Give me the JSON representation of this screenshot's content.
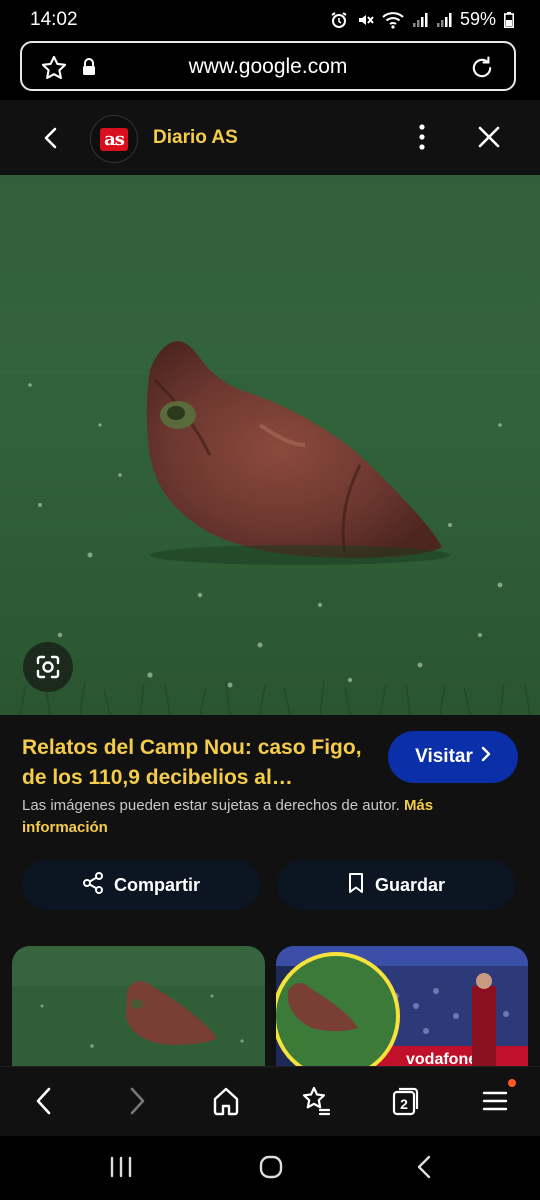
{
  "status_bar": {
    "time": "14:02",
    "battery": "59%"
  },
  "browser": {
    "url": "www.google.com",
    "tab_count": "2"
  },
  "header": {
    "site_name": "Diario AS",
    "logo_text": "as"
  },
  "result": {
    "title": "Relatos del Camp Nou: caso Figo, de los 110,9 decibelios al…",
    "visit_label": "Visitar",
    "copyright_text": "Las imágenes pueden estar sujetas a derechos de autor.",
    "more_info_label": "Más información",
    "share_label": "Compartir",
    "save_label": "Guardar"
  },
  "thumbnails": [
    {
      "banner_text": "vodafone"
    }
  ],
  "colors": {
    "accent": "#f5cc4a",
    "visit_button": "#0a2fa8",
    "background": "#111111"
  }
}
